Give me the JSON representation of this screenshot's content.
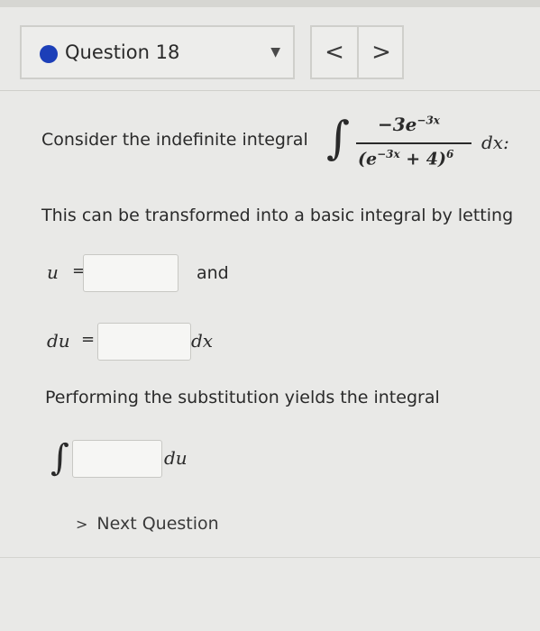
{
  "header": {
    "question_label": "Question 18",
    "prev_glyph": "<",
    "next_glyph": ">",
    "caret_glyph": "▼"
  },
  "problem": {
    "intro": "Consider the indefinite integral",
    "integral_sign": "∫",
    "numerator": "−3e",
    "numerator_exp": "−3x",
    "denominator_base": "(e",
    "denominator_inner_exp": "−3x",
    "denominator_rest": " + 4)",
    "denominator_power": "6",
    "differential": "dx:"
  },
  "instructions": {
    "transform_text": "This can be transformed into a basic integral by letting",
    "u_label": "u",
    "equals": "=",
    "and_text": "and",
    "du_label": "du",
    "dx_label": "dx",
    "substitution_text": "Performing the substitution yields the integral",
    "integral_sign": "∫",
    "du_suffix": "du"
  },
  "footer": {
    "next_chevron": ">",
    "next_label": "Next Question"
  },
  "colors": {
    "dot": "#1c3fb8",
    "background": "#e9e9e7"
  }
}
